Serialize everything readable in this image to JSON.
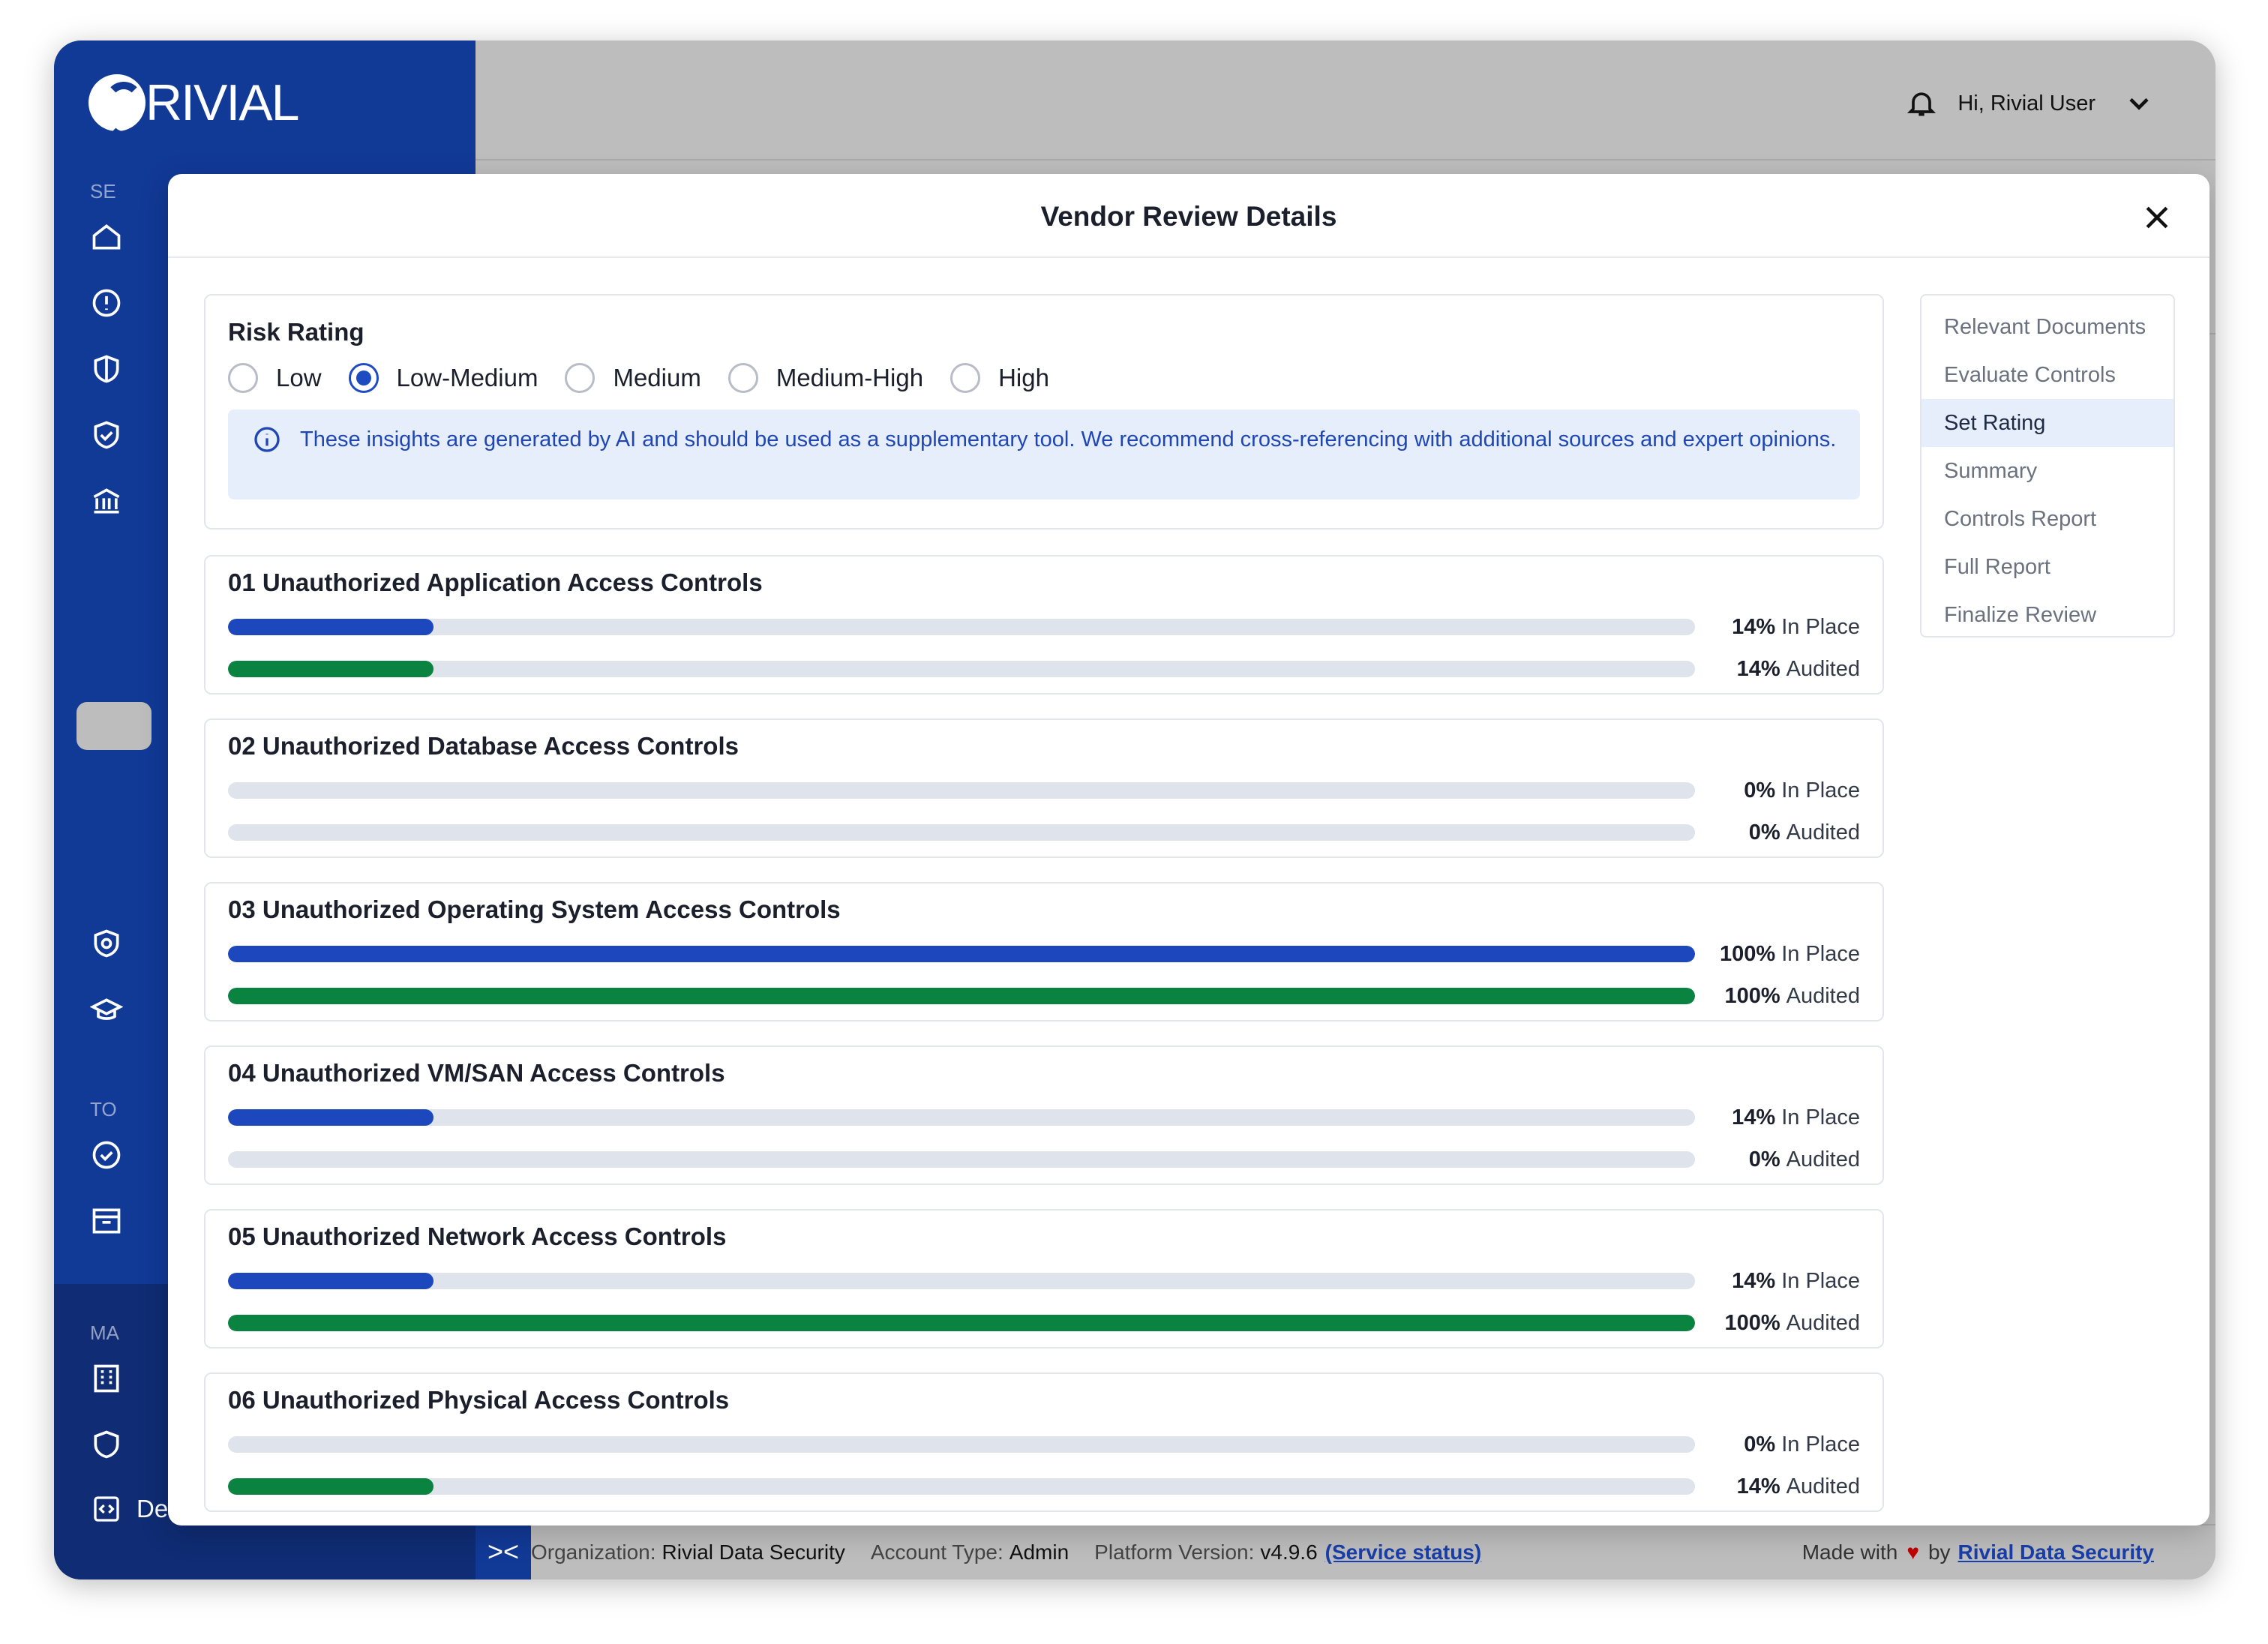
{
  "app": {
    "logo_text": "RIVIAL",
    "sidebar_section_1": "SE",
    "sidebar_section_2": "TO",
    "sidebar_section_3": "MA",
    "development_label": "Development",
    "collapse_label": "><"
  },
  "topbar": {
    "greeting": "Hi, Rivial User"
  },
  "modal": {
    "title": "Vendor Review Details"
  },
  "risk_rating": {
    "title": "Risk Rating",
    "options": [
      "Low",
      "Low-Medium",
      "Medium",
      "Medium-High",
      "High"
    ],
    "selected": "Low-Medium",
    "ai_note": "These insights are generated by AI and should be used as a supplementary tool. We recommend cross-referencing with additional sources and expert opinions."
  },
  "controls": [
    {
      "title": "01 Unauthorized Application Access Controls",
      "in_place": 14,
      "in_place_label": "14%",
      "audited": 14,
      "audited_label": "14%"
    },
    {
      "title": "02 Unauthorized Database Access Controls",
      "in_place": 0,
      "in_place_label": "0%",
      "audited": 0,
      "audited_label": "0%"
    },
    {
      "title": "03 Unauthorized Operating System Access Controls",
      "in_place": 100,
      "in_place_label": "100%",
      "audited": 100,
      "audited_label": "100%"
    },
    {
      "title": "04 Unauthorized VM/SAN Access Controls",
      "in_place": 14,
      "in_place_label": "14%",
      "audited": 0,
      "audited_label": "0%"
    },
    {
      "title": "05 Unauthorized Network Access Controls",
      "in_place": 14,
      "in_place_label": "14%",
      "audited": 100,
      "audited_label": "100%"
    },
    {
      "title": "06 Unauthorized Physical Access Controls",
      "in_place": 0,
      "in_place_label": "0%",
      "audited": 14,
      "audited_label": "14%"
    }
  ],
  "labels": {
    "in_place": "In Place",
    "audited": "Audited"
  },
  "colors": {
    "in_place_bar": "#1d47bd",
    "audited_bar": "#0a8341",
    "sidebar": "#113996"
  },
  "right_nav": {
    "items": [
      "Relevant Documents",
      "Evaluate Controls",
      "Set Rating",
      "Summary",
      "Controls Report",
      "Full Report",
      "Finalize Review"
    ],
    "active": "Set Rating"
  },
  "footer": {
    "org_label": "Organization:",
    "org_value": "Rivial Data Security",
    "account_label": "Account Type:",
    "account_value": "Admin",
    "version_label": "Platform Version:",
    "version_value": "v4.9.6",
    "status_link": "(Service status)",
    "made_with": "Made with",
    "by": "by",
    "company_link": "Rivial Data Security"
  }
}
